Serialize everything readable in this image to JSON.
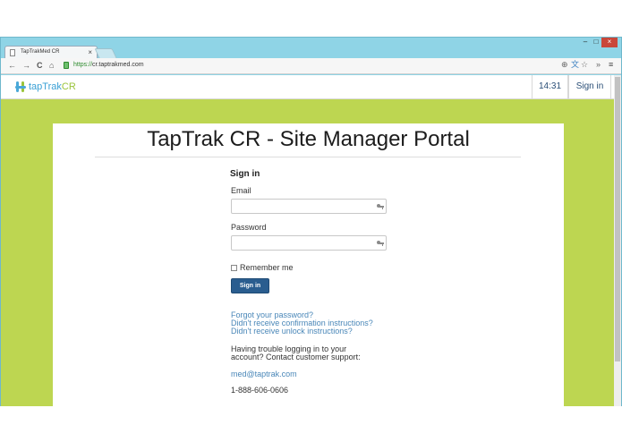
{
  "browser": {
    "tab_title": "TapTrakMed CR",
    "tab_close": "×",
    "url_scheme": "https://",
    "url_host": "cr.taptrakmed.com",
    "window_controls": {
      "minimize": "‒",
      "maximize": "□",
      "close": "×"
    },
    "nav": {
      "back": "←",
      "forward": "→",
      "reload": "C",
      "home": "⌂"
    },
    "toolbar_right": {
      "zoom": "⊕",
      "translate": "文",
      "bookmark": "☆",
      "extensions": "»",
      "menu": "≡"
    }
  },
  "site_nav": {
    "logo_tap": "tapTrak",
    "logo_cr": "CR",
    "clock": "14:31",
    "signin_link": "Sign in"
  },
  "page": {
    "title": "TapTrak CR - Site Manager Portal",
    "form": {
      "heading": "Sign in",
      "email_label": "Email",
      "email_value": "",
      "password_label": "Password",
      "password_value": "",
      "remember_label": "Remember me",
      "remember_checked": false,
      "submit_label": "Sign in"
    },
    "links": {
      "forgot": "Forgot your password?",
      "confirmation": "Didn't receive confirmation instructions?",
      "unlock": "Didn't receive unlock instructions?"
    },
    "support": {
      "text_line1": "Having trouble logging in to your",
      "text_line2": "account? Contact customer support:",
      "email": "med@taptrak.com",
      "phone": "1-888-606-0606"
    }
  },
  "colors": {
    "page_background": "#bdd651",
    "browser_frame": "#8fd4e6",
    "primary_button": "#2a5d8f",
    "link": "#4a87b8"
  }
}
